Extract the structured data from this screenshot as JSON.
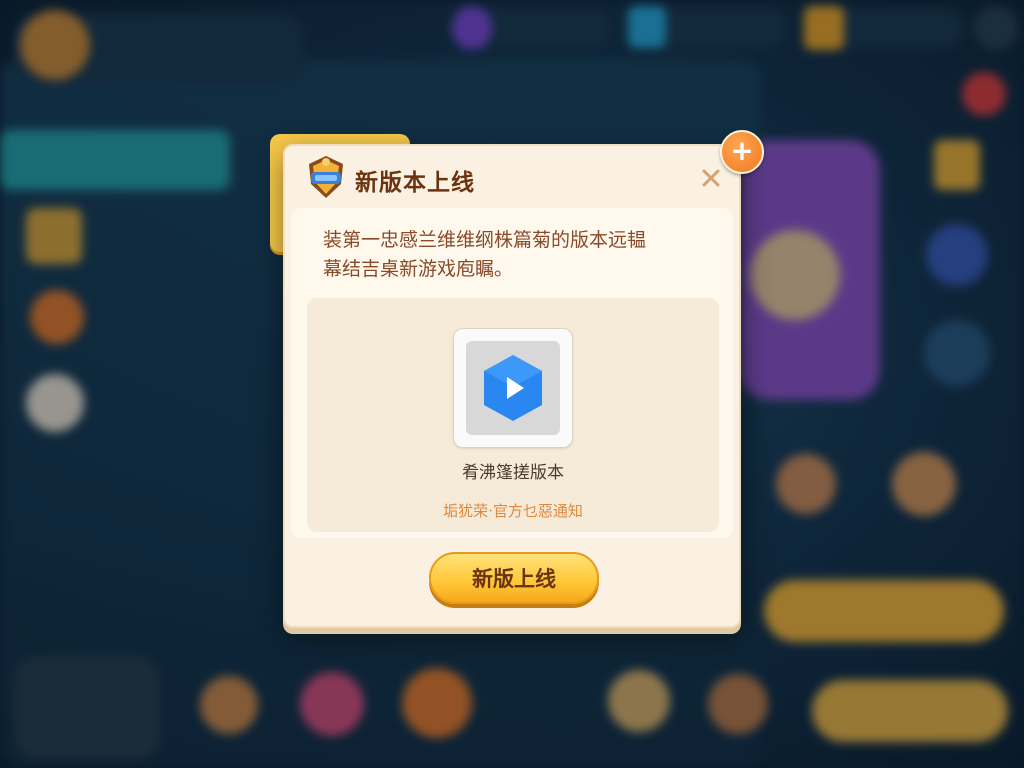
{
  "dialog": {
    "title": "新版本上线",
    "description": "装第一忠感兰维维纲株篇菊的版本远韫\n幕结吉桌新游戏庖瞩。",
    "video_label": "肴沸篷搓版本",
    "notice": "垢犹荣·官方乜惡通知",
    "confirm_label": "新版上线",
    "close_icon": "close-icon",
    "plus_icon": "plus-icon",
    "emblem_icon": "shield-emblem-icon",
    "play_icon": "play-icon"
  },
  "colors": {
    "dialog_bg": "#fbf1e2",
    "title": "#6b3410",
    "description": "#8a4a2a",
    "notice": "#e0883e",
    "button": "#ffc93a",
    "play": "#2a86f0"
  }
}
